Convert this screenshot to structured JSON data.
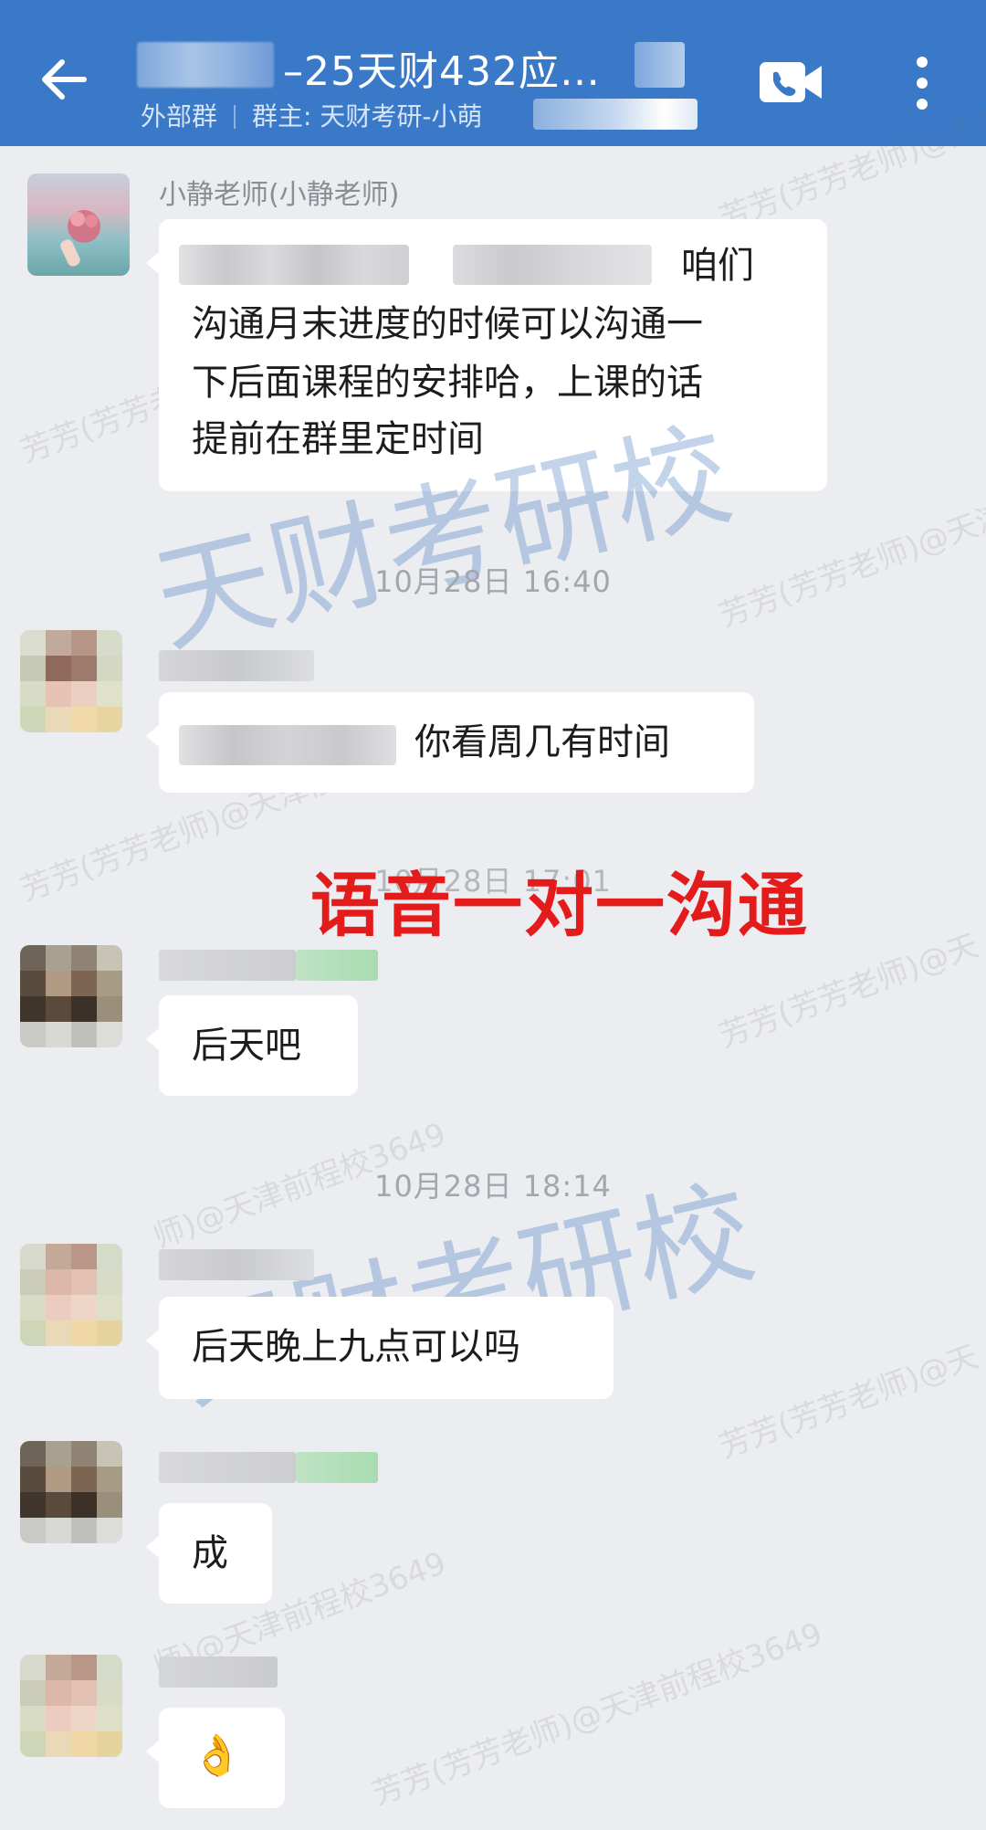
{
  "header": {
    "title": "–25天财432应…",
    "subtitle_group_type": "外部群",
    "subtitle_owner": "群主: 天财考研-小萌",
    "colors": {
      "bar": "#3a78c8",
      "text": "#ffffff"
    },
    "icons": {
      "back": "arrow-left-icon",
      "video": "video-call-icon",
      "more": "more-vertical-icon"
    }
  },
  "watermarks": {
    "big": "天财考研校",
    "small_teacher": "芳芳(芳芳老师)@天津前程校3649",
    "small_teacher_short": "芳芳(芳芳老师)@天",
    "small_school": "师)@天津前程校3649"
  },
  "messages": [
    {
      "sender": "小静老师(小静老师)",
      "text_lines": [
        "咱们",
        "沟通月末进度的时候可以沟通一",
        "下后面课程的安排哈，上课的话",
        "提前在群里定时间"
      ]
    },
    {
      "time": "10月28日  16:40"
    },
    {
      "sender": "",
      "text": "你看周几有时间"
    },
    {
      "time_obscured": "10月28日  17:01"
    },
    {
      "sender": "",
      "text": "后天吧"
    },
    {
      "time": "10月28日  18:14"
    },
    {
      "sender": "",
      "text": "后天晚上九点可以吗"
    },
    {
      "sender": "",
      "text": "成"
    },
    {
      "sender": "",
      "text": "👌"
    }
  ],
  "annotation": {
    "text": "语音一对一沟通",
    "color": "#e41b1b"
  }
}
